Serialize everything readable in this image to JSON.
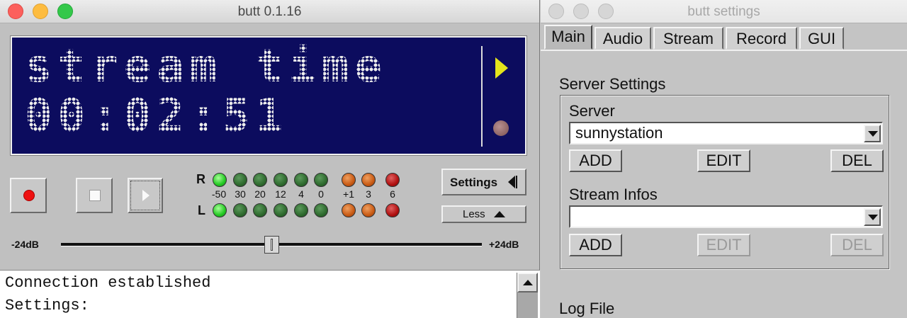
{
  "main_window": {
    "title": "butt 0.1.16",
    "display": {
      "line1": "stream time",
      "line2": "00:02:51"
    },
    "vu_meter": {
      "right_label": "R",
      "left_label": "L",
      "scale": [
        "-50",
        "30",
        "20",
        "12",
        "4",
        "0",
        "+1",
        "3",
        "6"
      ],
      "colors": {
        "green_on": "#22c822",
        "green_off": "#2e6a2e",
        "orange": "#c85a14",
        "red": "#b01010"
      }
    },
    "settings_button": "Settings",
    "less_button": "Less",
    "gain": {
      "min_label": "-24dB",
      "max_label": "+24dB",
      "value_fraction": 0.5
    },
    "log": [
      "Connection established",
      "Settings:"
    ]
  },
  "settings_window": {
    "title": "butt settings",
    "tabs": [
      "Main",
      "Audio",
      "Stream",
      "Record",
      "GUI"
    ],
    "active_tab": "Main",
    "server_settings": {
      "heading": "Server Settings",
      "server": {
        "label": "Server",
        "value": "sunnystation",
        "add": "ADD",
        "edit": "EDIT",
        "del": "DEL"
      },
      "stream_infos": {
        "label": "Stream Infos",
        "value": "",
        "add": "ADD",
        "edit": "EDIT",
        "del": "DEL"
      }
    },
    "log_file_heading": "Log File"
  }
}
